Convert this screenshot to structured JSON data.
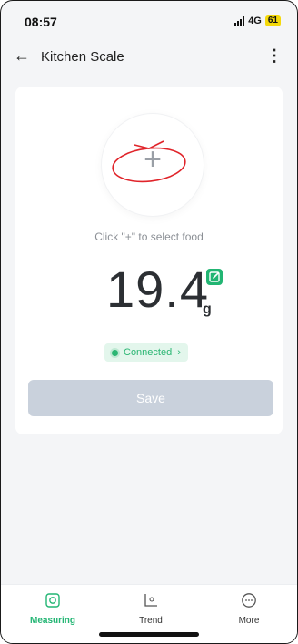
{
  "status_bar": {
    "time": "08:57",
    "network": "4G",
    "battery": "61"
  },
  "header": {
    "title": "Kitchen Scale"
  },
  "scale": {
    "add_symbol": "+",
    "hint": "Click \"+\" to select food",
    "weight": "19.4",
    "unit": "g",
    "connection_status": "Connected",
    "save_label": "Save"
  },
  "bottom_nav": {
    "items": [
      {
        "label": "Measuring",
        "icon": "scale-icon",
        "active": true
      },
      {
        "label": "Trend",
        "icon": "trend-chart-icon",
        "active": false
      },
      {
        "label": "More",
        "icon": "more-circle-icon",
        "active": false
      }
    ]
  },
  "colors": {
    "accent": "#22b573",
    "save_disabled": "#c9d1dc",
    "annotation": "#e0242a"
  }
}
